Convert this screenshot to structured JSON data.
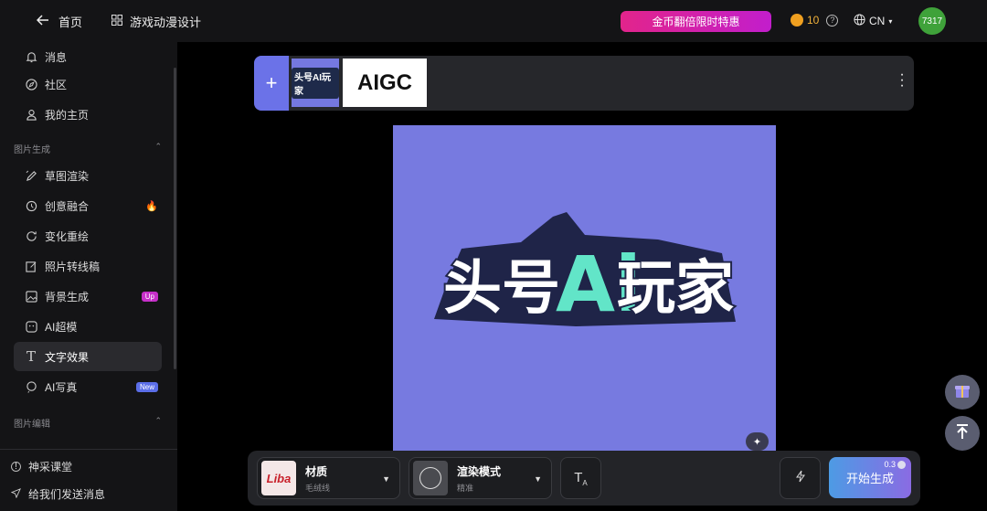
{
  "topbar": {
    "back_label": "首页",
    "project_title": "游戏动漫设计",
    "promo_label": "金币翻倍限时特惠",
    "coin_count": "10",
    "help_label": "?",
    "language": "CN",
    "avatar_text": "7317"
  },
  "sidebar": {
    "items_top": [
      {
        "label": "消息",
        "icon": "bell-icon"
      },
      {
        "label": "社区",
        "icon": "compass-icon"
      },
      {
        "label": "我的主页",
        "icon": "user-icon"
      }
    ],
    "section1": "图片生成",
    "section1_items": [
      {
        "label": "草图渲染",
        "icon": "sketch-icon"
      },
      {
        "label": "创意融合",
        "icon": "blend-icon"
      },
      {
        "label": "变化重绘",
        "icon": "refresh-icon"
      },
      {
        "label": "照片转线稿",
        "icon": "edit-icon"
      },
      {
        "label": "背景生成",
        "icon": "image-icon",
        "badge": "Up"
      },
      {
        "label": "AI超模",
        "icon": "face-icon"
      },
      {
        "label": "文字效果",
        "icon": "text-icon"
      },
      {
        "label": "AI写真",
        "icon": "portrait-icon",
        "badge": "New"
      }
    ],
    "section2": "图片编辑",
    "footer": [
      {
        "label": "神采课堂",
        "icon": "info-icon"
      },
      {
        "label": "给我们发送消息",
        "icon": "send-icon"
      }
    ]
  },
  "layers": {
    "thumb1_text": "头号AI玩家",
    "thumb2_text": "AIGC",
    "add_label": "+"
  },
  "canvas": {
    "logo_text": [
      "头号",
      "Ai",
      "玩家"
    ]
  },
  "toolbar": {
    "material_name": "材质",
    "material_sub": "毛绒线",
    "material_thumb": "Liba",
    "render_name": "渲染模式",
    "render_sub": "精准",
    "generate_label": "开始生成",
    "generate_cost": "0.3"
  },
  "colors": {
    "accent": "#6b72e8",
    "canvas_bg": "#777ae0",
    "promo": "#e2248b"
  }
}
